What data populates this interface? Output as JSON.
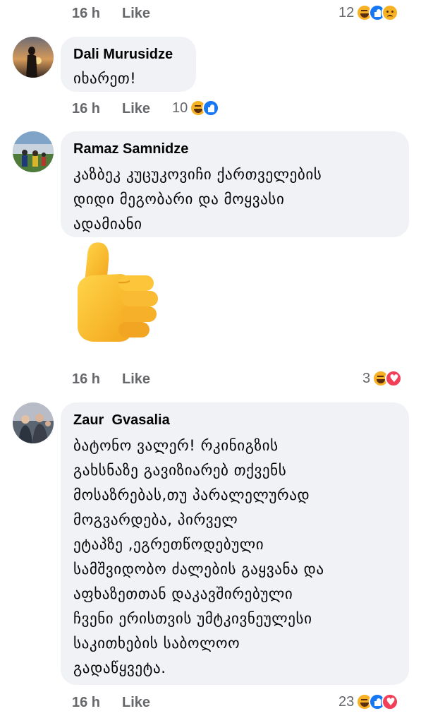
{
  "comments": [
    {
      "time": "16 h",
      "like_label": "Like",
      "reaction_count": "12",
      "reactions": [
        "haha-icon",
        "like-icon",
        "sad-icon"
      ]
    },
    {
      "author": "Dali Murusidze",
      "text": "იხარეთ!",
      "time": "16 h",
      "like_label": "Like",
      "reaction_count": "10",
      "reactions": [
        "haha-icon",
        "like-icon"
      ]
    },
    {
      "author": "Ramaz Samnidze",
      "text_lines": [
        "კაზბეკ კუცუკოვიჩი ქართველების",
        "დიდი მეგობარი და მოყვასი",
        "ადამიანი"
      ],
      "sticker": "thumbs-up-emoji",
      "time": "16 h",
      "like_label": "Like",
      "reaction_count": "3",
      "reactions": [
        "haha-icon",
        "love-icon"
      ]
    },
    {
      "author": "Zaur  Gvasalia",
      "text_lines": [
        "ბატონო ვალერ! რკინიგზის",
        "გახსნაზე გავიზიარებ თქვენს",
        "მოსაზრებას,თუ პარალელურად",
        "მოგვარდება, პირველ",
        "ეტაპზე ,ეგრეთწოდებული",
        "სამშვიდობო ძალების გაყვანა და",
        "აფხაზეთთან დაკავშირებული",
        "ჩვენი ერისთვის უმტკივნეულესი",
        "საკითხების საბოლოო",
        "გადაწყვეტა."
      ],
      "time": "16 h",
      "like_label": "Like",
      "reaction_count": "23",
      "reactions": [
        "haha-icon",
        "like-icon",
        "love-icon"
      ]
    }
  ],
  "colors": {
    "bubble": "#f0f2f5",
    "meta_text": "#65676b",
    "like_blue": "#1877f2",
    "haha_yellow": "#f7b125",
    "love_red": "#f33e58"
  }
}
